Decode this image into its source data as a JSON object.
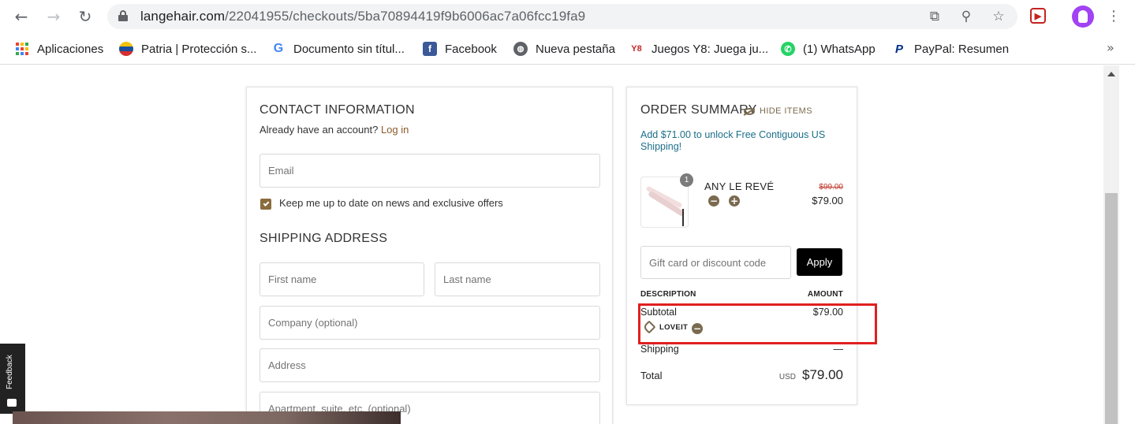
{
  "browser": {
    "url_host": "langehair.com",
    "url_path": "/22041955/checkouts/5ba70894419f9b6006ac7a06fcc19fa9",
    "bookmarks": [
      {
        "label": "Aplicaciones",
        "icon": "apps-grid-icon"
      },
      {
        "label": "Patria | Protección s...",
        "icon": "patria-icon"
      },
      {
        "label": "Documento sin títul...",
        "icon": "google-icon"
      },
      {
        "label": "Facebook",
        "icon": "facebook-icon"
      },
      {
        "label": "Nueva pestaña",
        "icon": "globe-icon"
      },
      {
        "label": "Juegos Y8: Juega ju...",
        "icon": "y8-icon"
      },
      {
        "label": "(1) WhatsApp",
        "icon": "whatsapp-icon"
      },
      {
        "label": "PayPal: Resumen",
        "icon": "paypal-icon"
      }
    ]
  },
  "contact": {
    "title": "CONTACT INFORMATION",
    "account_prompt": "Already have an account?",
    "login_link": "Log in",
    "email_placeholder": "Email",
    "newsletter_label": "Keep me up to date on news and exclusive offers",
    "newsletter_checked": true
  },
  "shipping": {
    "title": "SHIPPING ADDRESS",
    "first_name_placeholder": "First name",
    "last_name_placeholder": "Last name",
    "company_placeholder": "Company (optional)",
    "address_placeholder": "Address",
    "apartment_placeholder": "Apartment, suite, etc. (optional)"
  },
  "summary": {
    "title": "ORDER SUMMARY",
    "hide_items": "HIDE ITEMS",
    "promo_text": "Add $71.00 to unlock Free Contiguous US Shipping!",
    "item": {
      "name": "ANY LE REVÉ",
      "quantity": "1",
      "original_price": "$99.00",
      "price": "$79.00"
    },
    "discount_placeholder": "Gift card or discount code",
    "apply_label": "Apply",
    "description_header": "DESCRIPTION",
    "amount_header": "AMOUNT",
    "subtotal_label": "Subtotal",
    "subtotal_value": "$79.00",
    "coupon_code": "LOVEIT",
    "shipping_label": "Shipping",
    "shipping_value": "—",
    "total_label": "Total",
    "total_currency": "USD",
    "total_value": "$79.00"
  },
  "feedback_label": "Feedback",
  "colors": {
    "accent_brown": "#8a6c3d",
    "promo_teal": "#1c6f8a",
    "highlight_red": "#e02020"
  }
}
